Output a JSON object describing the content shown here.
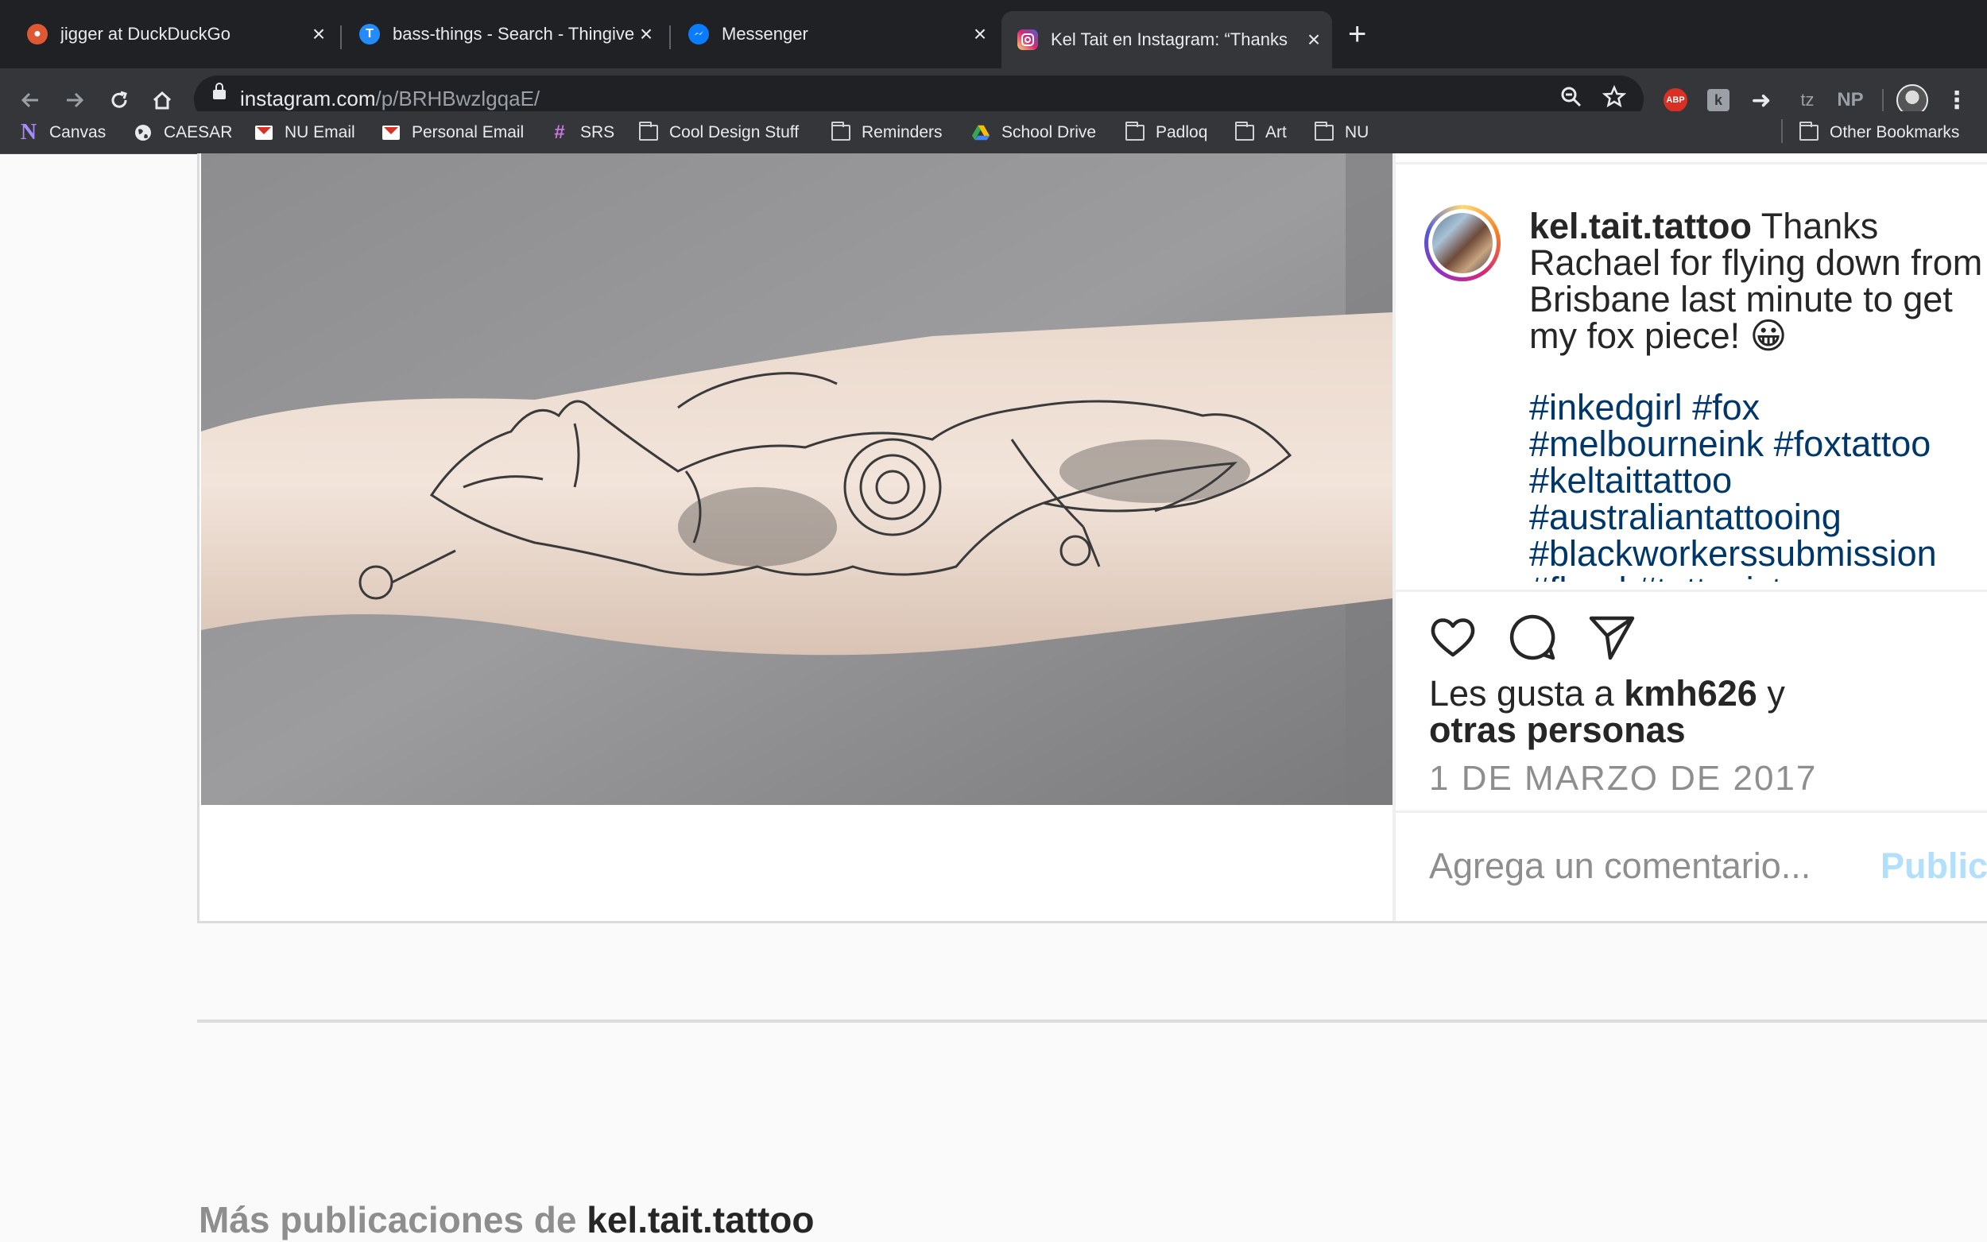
{
  "browser": {
    "tabs": [
      {
        "title": "jigger at DuckDuckGo",
        "icon": "duckduckgo-icon",
        "active": false
      },
      {
        "title": "bass-things - Search - Thingiverse",
        "icon": "thingiverse-icon",
        "active": false
      },
      {
        "title": "Messenger",
        "icon": "messenger-icon",
        "active": false
      },
      {
        "title": "Kel Tait en Instagram: “Thanks",
        "icon": "instagram-icon",
        "active": true
      }
    ],
    "url_host": "instagram.com",
    "url_path": "/p/BRHBwzlgqaE/",
    "extensions": [
      "ABP",
      "tz",
      "NP"
    ],
    "bookmarks": [
      {
        "label": "Canvas",
        "icon": "canvas-icon"
      },
      {
        "label": "CAESAR",
        "icon": "globe-icon"
      },
      {
        "label": "NU Email",
        "icon": "gmail-icon"
      },
      {
        "label": "Personal Email",
        "icon": "gmail-icon"
      },
      {
        "label": "SRS",
        "icon": "slack-icon"
      },
      {
        "label": "Cool Design Stuff",
        "icon": "folder-icon"
      },
      {
        "label": "Reminders",
        "icon": "folder-icon"
      },
      {
        "label": "School Drive",
        "icon": "drive-icon"
      },
      {
        "label": "Padloq",
        "icon": "folder-icon"
      },
      {
        "label": "Art",
        "icon": "folder-icon"
      },
      {
        "label": "NU",
        "icon": "folder-icon"
      }
    ],
    "other_bookmarks": "Other Bookmarks"
  },
  "post": {
    "username": "kel.tait.tattoo",
    "caption_lines": [
      "Thanks",
      "Rachael for flying down from",
      "Brisbane last minute to get",
      "my fox piece! 😀"
    ],
    "hashtag_lines": [
      "#inkedgirl #fox",
      "#melbourneink #foxtattoo",
      "#keltaittattoo",
      "#australiantattooing",
      "#blackworkerssubmission",
      "#floral #tattooist"
    ],
    "likes_prefix": "Les gusta a",
    "likes_user": "kmh626",
    "likes_and": "y",
    "likes_others": "otras personas",
    "date": "1 DE MARZO DE 2017",
    "comment_placeholder": "Agrega un comentario...",
    "publish_label": "Publicar"
  },
  "more": {
    "prefix": "Más publicaciones de",
    "username": "kel.tait.tattoo"
  },
  "colors": {
    "hashtag": "#00376b",
    "muted": "#8e8e8e",
    "publish_disabled": "#b2dffc"
  }
}
